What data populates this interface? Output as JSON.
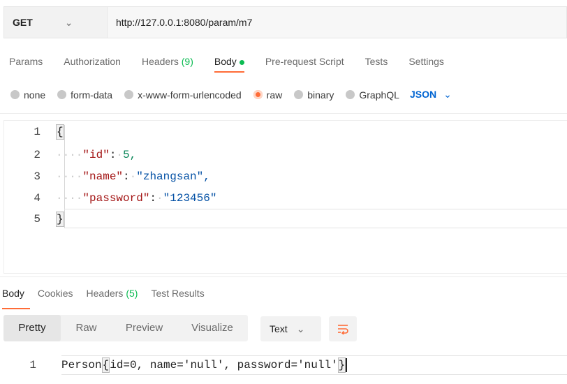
{
  "request": {
    "method": "GET",
    "url": "http://127.0.0.1:8080/param/m7"
  },
  "request_tabs": [
    {
      "label": "Params"
    },
    {
      "label": "Authorization"
    },
    {
      "label": "Headers",
      "count": "(9)"
    },
    {
      "label": "Body"
    },
    {
      "label": "Pre-request Script"
    },
    {
      "label": "Tests"
    },
    {
      "label": "Settings"
    }
  ],
  "body_types": [
    "none",
    "form-data",
    "x-www-form-urlencoded",
    "raw",
    "binary",
    "GraphQL"
  ],
  "body_format": "JSON",
  "editor": {
    "line_numbers": [
      "1",
      "2",
      "3",
      "4",
      "5"
    ],
    "open_brace": "{",
    "close_brace": "}",
    "fields": [
      {
        "key": "\"id\"",
        "value": "5,"
      },
      {
        "key": "\"name\"",
        "value": "\"zhangsan\","
      },
      {
        "key": "\"password\"",
        "value": "\"123456\""
      }
    ],
    "indent_dots": "····",
    "colon": ":"
  },
  "response_tabs": [
    {
      "label": "Body"
    },
    {
      "label": "Cookies"
    },
    {
      "label": "Headers",
      "count": "(5)"
    },
    {
      "label": "Test Results"
    }
  ],
  "view_modes": [
    "Pretty",
    "Raw",
    "Preview",
    "Visualize"
  ],
  "response_format": "Text",
  "response": {
    "line_number": "1",
    "prefix": "Person",
    "open_brace": "{",
    "content": "id=0, name='null', password='null'",
    "close_brace": "}"
  },
  "colors": {
    "accent": "#ff6c37",
    "success": "#0cbb52",
    "link": "#0265d2"
  },
  "icons": {
    "method_dropdown": "chevron-down-icon",
    "format_dropdown": "chevron-down-icon",
    "wrap_lines": "wrap-lines-icon"
  }
}
